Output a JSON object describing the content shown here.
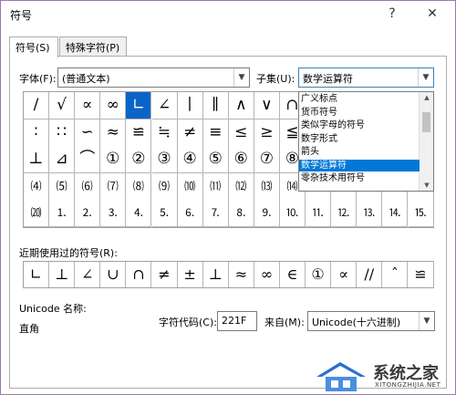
{
  "window": {
    "title": "符号",
    "help_label": "?",
    "close_label": "✕"
  },
  "tabs": [
    {
      "label": "符号(S)",
      "active": true
    },
    {
      "label": "特殊字符(P)",
      "active": false
    }
  ],
  "font": {
    "label": "字体(F):",
    "value": "(普通文本)"
  },
  "subset": {
    "label": "子集(U):",
    "value": "数学运算符",
    "options": [
      "广义标点",
      "货币符号",
      "类似字母的符号",
      "数字形式",
      "箭头",
      "数学运算符",
      "零杂技术用符号"
    ],
    "highlighted_index": 5
  },
  "symbol_grid": {
    "rows": [
      [
        "/",
        "√",
        "∝",
        "∞",
        "∟",
        "∠",
        "∣",
        "∥",
        "∧",
        "∨",
        "∩",
        "",
        "",
        "",
        "",
        ""
      ],
      [
        "∶",
        "∷",
        "∽",
        "≈",
        "≌",
        "≒",
        "≠",
        "≡",
        "≤",
        "≥",
        "≦",
        "",
        "",
        "",
        "",
        ""
      ],
      [
        "⊥",
        "⊿",
        "⌒",
        "①",
        "②",
        "③",
        "④",
        "⑤",
        "⑥",
        "⑦",
        "⑧",
        "",
        "",
        "",
        "",
        ""
      ],
      [
        "⑷",
        "⑸",
        "⑹",
        "⑺",
        "⑻",
        "⑼",
        "⑽",
        "⑾",
        "⑿",
        "⒀",
        "⒁",
        "⒂",
        "⒃",
        "⒄",
        "⒅",
        "⒆"
      ],
      [
        "⒇",
        "⒈",
        "⒉",
        "⒊",
        "⒋",
        "⒌",
        "⒍",
        "⒎",
        "⒏",
        "⒐",
        "⒑",
        "⒒",
        "⒓",
        "⒔",
        "⒕",
        "⒖"
      ]
    ],
    "selected": {
      "row": 0,
      "col": 4
    }
  },
  "recent": {
    "label": "近期使用过的符号(R):",
    "symbols": [
      "∟",
      "⊥",
      "∠",
      "∪",
      "∩",
      "≠",
      "±",
      "⊥",
      "≈",
      "∞",
      "∈",
      "①",
      "∝",
      "//",
      "ˆ",
      "≌"
    ]
  },
  "unicode_name": {
    "label": "Unicode 名称:",
    "value": "直角"
  },
  "char_code": {
    "label": "字符代码(C):",
    "value": "221F"
  },
  "from": {
    "label": "来自(M):",
    "value": "Unicode(十六进制)"
  },
  "watermark": {
    "text": "系统之家",
    "sub": "XITONGZHIJIA.NET"
  },
  "colors": {
    "selection": "#0a64c8",
    "highlight": "#0078d7",
    "window_border": "#9d76b8"
  }
}
